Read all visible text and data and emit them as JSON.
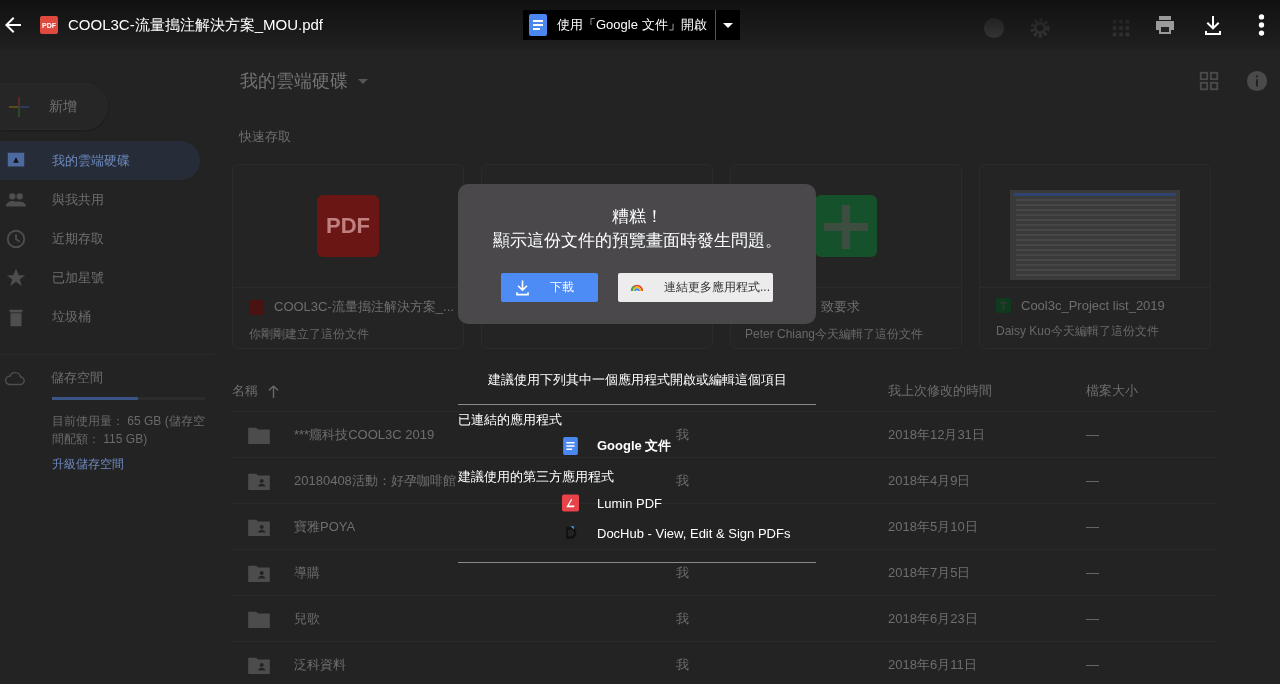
{
  "drive": {
    "new_button": {
      "label": "新增"
    },
    "nav": [
      {
        "kind": "drive",
        "label": "我的雲端硬碟",
        "selected": true
      },
      {
        "kind": "shared",
        "label": "與我共用",
        "selected": false
      },
      {
        "kind": "recent",
        "label": "近期存取",
        "selected": false
      },
      {
        "kind": "starred",
        "label": "已加星號",
        "selected": false
      },
      {
        "kind": "trash",
        "label": "垃圾桶",
        "selected": false
      }
    ],
    "storage": {
      "label": "儲存空間",
      "level": 0.56,
      "usage": "目前使用量： 65 GB (儲存空間配額： 115 GB)",
      "upgrade": "升級儲存空間"
    },
    "heading": "我的雲端硬碟",
    "quick_access": {
      "label": "快速存取",
      "cards": [
        {
          "kind": "pdf",
          "thumb_label": "PDF",
          "title": "COOL3C-流量搗注解決方案_...",
          "subtitle": "你剛剛建立了這份文件"
        },
        {
          "kind": "blank"
        },
        {
          "kind": "form",
          "title": "致要求",
          "subtitle": "Peter Chiang今天編輯了這份文件"
        },
        {
          "kind": "sheet",
          "title": "Cool3c_Project list_2019",
          "subtitle": "Daisy Kuo今天編輯了這份文件"
        }
      ]
    },
    "files": {
      "columns": [
        {
          "kind": "name",
          "label": "名稱"
        },
        {
          "kind": "modified",
          "label": "我上次修改的時間"
        },
        {
          "kind": "size",
          "label": "檔案大小"
        }
      ],
      "rows": [
        {
          "kind": "folder",
          "name": "***癮科技COOL3C 2019",
          "owner": "我",
          "modified": "2018年12月31日",
          "size": "—"
        },
        {
          "kind": "shared",
          "name": "20180408活動：好孕咖啡館",
          "owner": "我",
          "modified": "2018年4月9日",
          "size": "—"
        },
        {
          "kind": "shared",
          "name": "寶雅POYA",
          "modified": "2018年5月10日",
          "size": "—"
        },
        {
          "kind": "shared",
          "name": "導購",
          "owner": "我",
          "modified": "2018年7月5日",
          "size": "—"
        },
        {
          "kind": "folder",
          "name": "兒歌",
          "owner": "我",
          "modified": "2018年6月23日",
          "size": "—"
        },
        {
          "kind": "shared",
          "name": "泛科資料",
          "owner": "我",
          "modified": "2018年6月11日",
          "size": "—"
        }
      ]
    }
  },
  "viewer": {
    "file_badge": "PDF",
    "title": "COOL3C-流量搗注解決方案_MOU.pdf",
    "open_with": {
      "label": "使用「Google 文件」開啟"
    }
  },
  "dialog": {
    "title": "糟糕！",
    "message": "顯示這份文件的預覽畫面時發生問題。",
    "buttons": [
      {
        "kind": "download",
        "label": "下載"
      },
      {
        "kind": "connect",
        "label": "連結更多應用程式..."
      }
    ]
  },
  "suggestions": {
    "heading": "建議使用下列其中一個應用程式開啟或編輯這個項目",
    "sections": [
      {
        "label": "已連結的應用程式",
        "apps": [
          {
            "kind": "docs",
            "name": "Google 文件"
          }
        ]
      },
      {
        "label": "建議使用的第三方應用程式",
        "apps": [
          {
            "kind": "lumin",
            "name": "Lumin PDF"
          },
          {
            "kind": "dochub",
            "name": "DocHub - View, Edit & Sign PDFs"
          }
        ]
      }
    ]
  }
}
